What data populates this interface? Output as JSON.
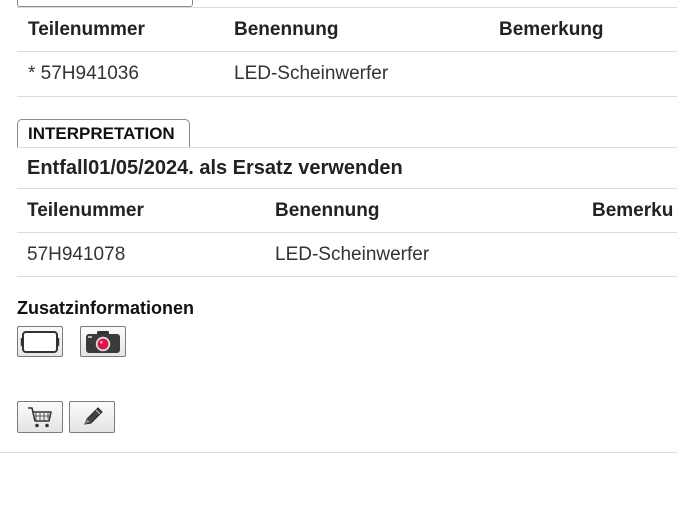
{
  "table1": {
    "headers": [
      "Teilenummer",
      "Benennung",
      "Bemerkung"
    ],
    "rows": [
      [
        "* 57H941036",
        "LED-Scheinwerfer",
        ""
      ]
    ]
  },
  "interpretation": {
    "tab_label": "INTERPRETATION",
    "text": "Entfall01/05/2024. als Ersatz verwenden"
  },
  "table2": {
    "headers": [
      "Teilenummer",
      "Benennung",
      "Bemerku"
    ],
    "rows": [
      [
        "57H941078",
        "LED-Scheinwerfer",
        ""
      ]
    ]
  },
  "zusatz": {
    "title": "Zusatzinformationen",
    "buttons": [
      {
        "icon": "image-frame-icon"
      },
      {
        "icon": "camera-icon"
      }
    ]
  },
  "actions": {
    "buttons": [
      {
        "icon": "shopping-cart-icon"
      },
      {
        "icon": "pencil-icon"
      }
    ]
  },
  "colors": {
    "border": "#8a8a8a",
    "divider": "#dcdcdc",
    "camera_lens": "#e0104a"
  }
}
